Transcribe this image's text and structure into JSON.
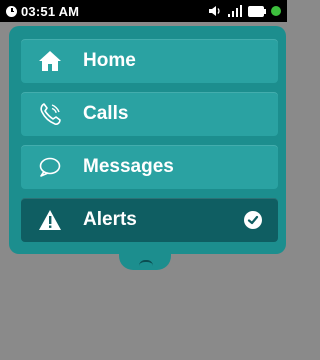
{
  "status_bar": {
    "time": "03:51 AM",
    "icons": [
      "clock-icon",
      "speaker-icon",
      "signal-icon",
      "battery-icon",
      "status-dot"
    ]
  },
  "menu": {
    "items": [
      {
        "label": "Home",
        "icon": "home-icon"
      },
      {
        "label": "Calls",
        "icon": "phone-icon"
      },
      {
        "label": "Messages",
        "icon": "chat-bubble-icon"
      },
      {
        "label": "Alerts",
        "icon": "warning-icon",
        "selected": true,
        "indicator": "checkmark-icon"
      }
    ]
  },
  "colors": {
    "panel": "#1c8e8e",
    "item": "#2aa2a2",
    "item_active": "#0f5e62",
    "background": "#8a8a8a",
    "status_bar": "#000000",
    "status_dot": "#3dbf3d"
  }
}
